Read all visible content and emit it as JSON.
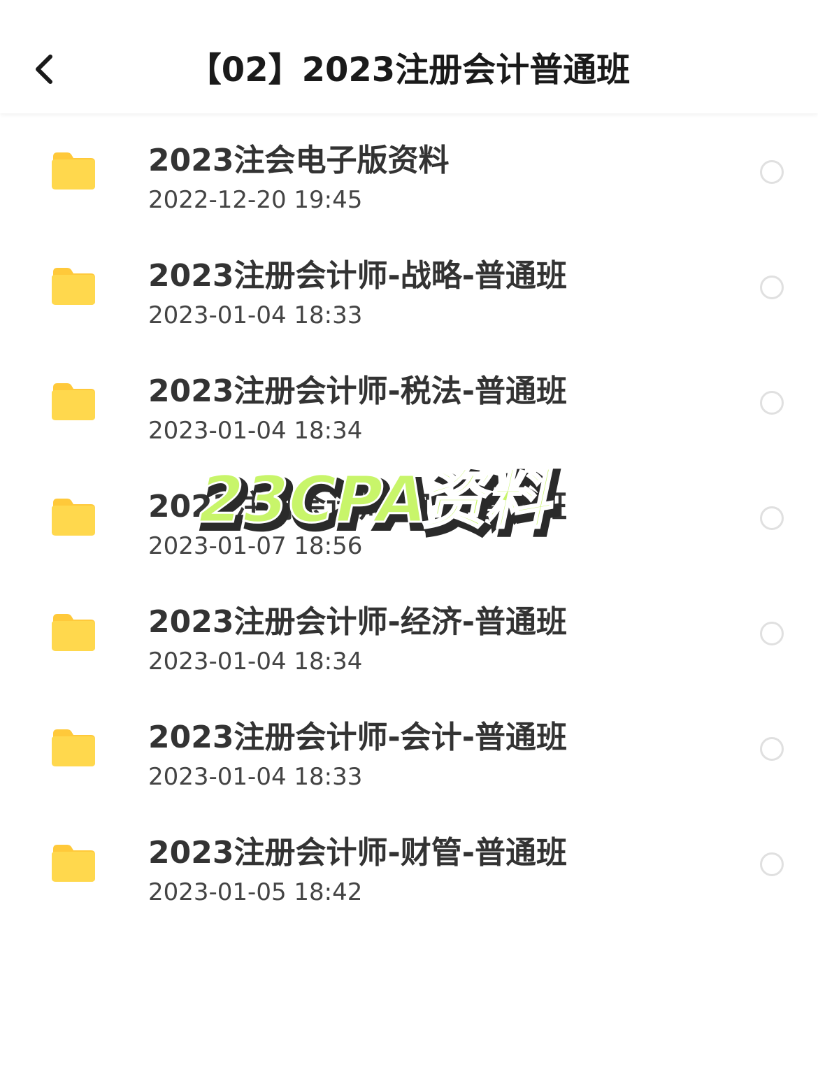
{
  "header": {
    "title": "【02】2023注册会计普通班"
  },
  "files": [
    {
      "name": "2023注会电子版资料",
      "date": "2022-12-20 19:45"
    },
    {
      "name": "2023注册会计师-战略-普通班",
      "date": "2023-01-04 18:33"
    },
    {
      "name": "2023注册会计师-税法-普通班",
      "date": "2023-01-04 18:34"
    },
    {
      "name": "2023注册会计师-审计-普通班",
      "date": "2023-01-07 18:56"
    },
    {
      "name": "2023注册会计师-经济-普通班",
      "date": "2023-01-04 18:34"
    },
    {
      "name": "2023注册会计师-会计-普通班",
      "date": "2023-01-04 18:33"
    },
    {
      "name": "2023注册会计师-财管-普通班",
      "date": "2023-01-05 18:42"
    }
  ],
  "watermark": {
    "text": "23CPA资料"
  },
  "icons": {
    "back": "chevron-left-icon",
    "folder": "folder-icon",
    "select": "radio-circle-icon"
  },
  "colors": {
    "folder": "#FFD84D",
    "folder_tab": "#FFC93A",
    "title_text": "#1a1a1a",
    "name_text": "#333333",
    "date_text": "#444444",
    "radio_border": "#e0e0e0",
    "watermark_fill": "#c8f56a",
    "watermark_stroke": "#2a2a2a"
  }
}
